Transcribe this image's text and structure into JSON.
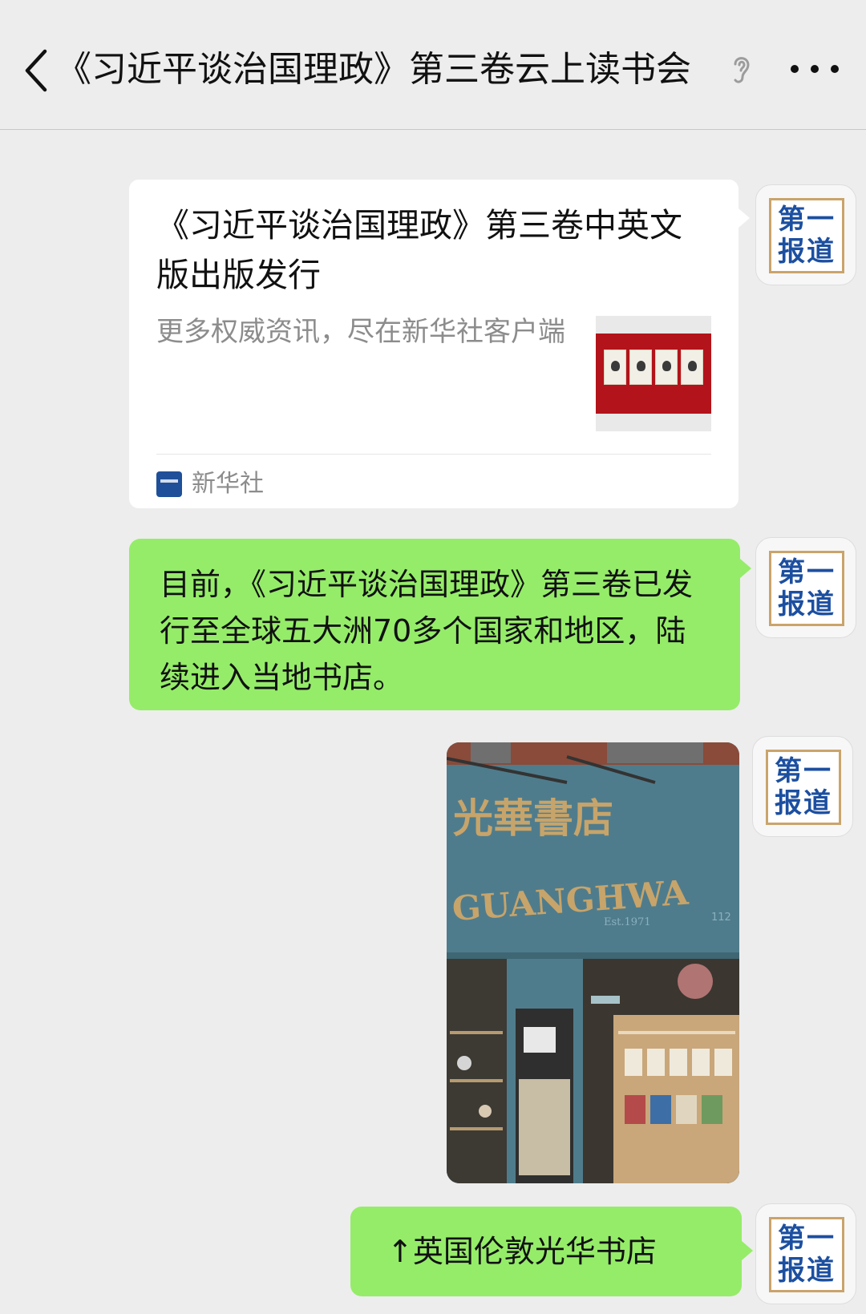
{
  "header": {
    "title": "《习近平谈治国理政》第三卷云上读书会"
  },
  "avatar": {
    "text": "第一报道"
  },
  "messages": {
    "card": {
      "title": "《习近平谈治国理政》第三卷中英文版出版发行",
      "description": "更多权威资讯，尽在新华社客户端",
      "source": "新华社"
    },
    "text1": "目前，《习近平谈治国理政》第三卷已发行至全球五大洲70多个国家和地区，陆续进入当地书店。",
    "photo": {
      "sign_cn": "光華書店",
      "sign_en": "GUANGHWA",
      "est": "Est.1971",
      "number": "112"
    },
    "text2": "↑英国伦敦光华书店"
  },
  "colors": {
    "background": "#ededed",
    "bubble_green": "#95ec69",
    "card_white": "#ffffff",
    "avatar_blue": "#1c4fa0",
    "avatar_gold": "#caa46b",
    "shop_teal": "#4f7c8c"
  }
}
